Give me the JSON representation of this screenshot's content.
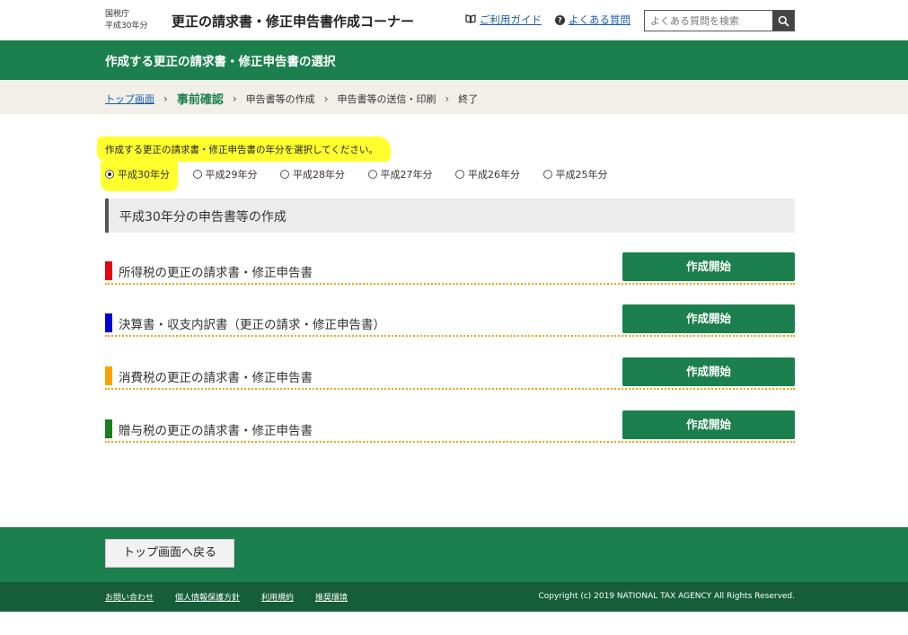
{
  "header": {
    "agency": "国税庁",
    "fiscal_year": "平成30年分",
    "app_title": "更正の請求書・修正申告書作成コーナー",
    "guide_link": "ご利用ガイド",
    "faq_link": "よくある質問",
    "search_placeholder": "よくある質問を検索",
    "icons": {
      "guide": "book-icon",
      "faq": "question-icon",
      "search": "search-icon"
    }
  },
  "page_title": "作成する更正の請求書・修正申告書の選択",
  "steps": [
    {
      "label": "トップ画面",
      "state": "link"
    },
    {
      "label": "事前確認",
      "state": "current"
    },
    {
      "label": "申告書等の作成",
      "state": "pending"
    },
    {
      "label": "申告書等の送信・印刷",
      "state": "pending"
    },
    {
      "label": "終了",
      "state": "pending"
    }
  ],
  "year_selection": {
    "instruction": "作成する更正の請求書・修正申告書の年分を選択してください。",
    "options": [
      "平成30年分",
      "平成29年分",
      "平成28年分",
      "平成27年分",
      "平成26年分",
      "平成25年分"
    ],
    "selected": "平成30年分"
  },
  "section_title": "平成30年分の申告書等の作成",
  "forms": [
    {
      "label": "所得税の更正の請求書・修正申告書",
      "button": "作成開始",
      "color": "#e60012"
    },
    {
      "label": "決算書・収支内訳書（更正の請求・修正申告書）",
      "button": "作成開始",
      "color": "#0000cc"
    },
    {
      "label": "消費税の更正の請求書・修正申告書",
      "button": "作成開始",
      "color": "#f5a300"
    },
    {
      "label": "贈与税の更正の請求書・修正申告書",
      "button": "作成開始",
      "color": "#1b7f1b"
    }
  ],
  "footer": {
    "back_button": "トップ画面へ戻る",
    "links": [
      "お問い合わせ",
      "個人情報保護方針",
      "利用規約",
      "推奨環境"
    ],
    "copyright": "Copyright (c) 2019 NATIONAL TAX AGENCY All Rights Reserved."
  },
  "colors": {
    "primary_green": "#1b7f4e",
    "highlight": "#ffff2e",
    "link": "#1a5ea8"
  }
}
